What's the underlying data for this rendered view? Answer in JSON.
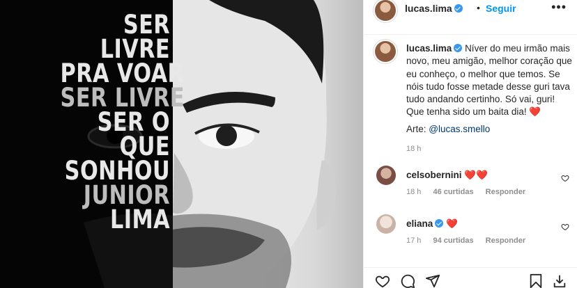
{
  "poster": {
    "lines": [
      "SER",
      "LIVRE",
      "PRA VOAR",
      "SER LIVRE",
      "SER O",
      "QUE",
      "SONHOU",
      "JUNIOR",
      "LIMA"
    ]
  },
  "header": {
    "username": "lucas.lima",
    "separator": "•",
    "follow_label": "Seguir",
    "more_icon": "more-icon",
    "more_glyph": "•••"
  },
  "caption": {
    "username": "lucas.lima",
    "text": "Níver do meu irmão mais novo, meu amigão, melhor coração que eu conheço, o melhor que temos. Se nóis tudo fosse metade desse guri tava tudo andando certinho. Só vai, guri! Que tenha sido um baita dia!",
    "emoji": "❤️",
    "art_prefix": "Arte:",
    "art_mention": "@lucas.smello",
    "time": "18 h"
  },
  "comments": [
    {
      "username": "celsobernini",
      "text": "❤️❤️",
      "time": "18 h",
      "likes": "46 curtidas",
      "reply": "Responder"
    },
    {
      "username": "eliana",
      "verified": true,
      "text": "❤️",
      "time": "17 h",
      "likes": "94 curtidas",
      "reply": "Responder"
    }
  ],
  "actions": [
    "heart-icon",
    "comment-icon",
    "share-icon",
    "save-icon",
    "download-icon"
  ],
  "colors": {
    "accent": "#0095f6",
    "verified": "#3897f0",
    "heart": "#ed4956",
    "muted": "#8e8e8e"
  }
}
